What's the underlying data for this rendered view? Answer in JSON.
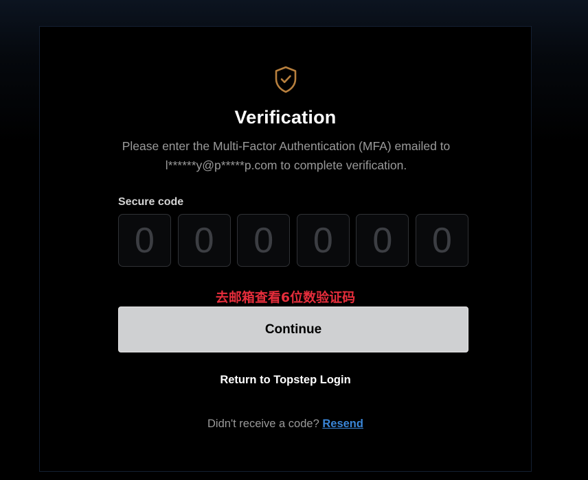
{
  "header": {
    "title": "Verification",
    "description": "Please enter the Multi-Factor Authentication (MFA) emailed to l******y@p*****p.com to complete verification."
  },
  "icons": {
    "shield": "shield-check-icon",
    "shield_color": "#b8803e"
  },
  "form": {
    "code_label": "Secure code",
    "code_digits": [
      "0",
      "0",
      "0",
      "0",
      "0",
      "0"
    ]
  },
  "annotation": {
    "hint": "去邮箱查看6位数验证码",
    "color": "#e52d3b"
  },
  "actions": {
    "continue_label": "Continue",
    "return_label": "Return to Topstep Login",
    "resend_prompt": "Didn't receive a code?",
    "resend_label": "Resend"
  }
}
